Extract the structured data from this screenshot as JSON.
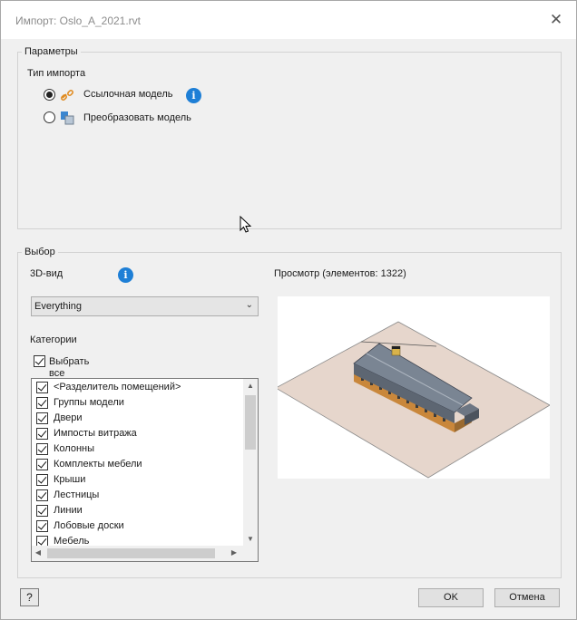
{
  "window": {
    "title": "Импорт: Oslo_A_2021.rvt",
    "close_glyph": "✕"
  },
  "params": {
    "legend": "Параметры",
    "import_type_label": "Тип импорта",
    "options": [
      {
        "label": "Ссылочная модель",
        "selected": true,
        "icon": "link-icon"
      },
      {
        "label": "Преобразовать модель",
        "selected": false,
        "icon": "convert-model-icon"
      }
    ],
    "info_glyph": "i"
  },
  "selection": {
    "legend": "Выбор",
    "view_label": "3D-вид",
    "view_value": "Everything",
    "categories_label": "Категории",
    "select_all_line1": "Выбрать",
    "select_all_line2": "все",
    "select_all_checked": true,
    "categories": [
      {
        "label": "<Разделитель помещений>",
        "checked": true
      },
      {
        "label": "Группы модели",
        "checked": true
      },
      {
        "label": "Двери",
        "checked": true
      },
      {
        "label": "Импосты витража",
        "checked": true
      },
      {
        "label": "Колонны",
        "checked": true
      },
      {
        "label": "Комплекты мебели",
        "checked": true
      },
      {
        "label": "Крыши",
        "checked": true
      },
      {
        "label": "Лестницы",
        "checked": true
      },
      {
        "label": "Линии",
        "checked": true
      },
      {
        "label": "Лобовые доски",
        "checked": true
      },
      {
        "label": "Мебель",
        "checked": true
      }
    ]
  },
  "preview": {
    "label": "Просмотр (элементов: 1322)"
  },
  "footer": {
    "ok_label": "OK",
    "cancel_label": "Отмена",
    "help_glyph": "?"
  },
  "colors": {
    "info_blue": "#1e7fd6",
    "ground": "#e6d6cc",
    "roof": "#7a8593",
    "wall": "#c9873b"
  }
}
